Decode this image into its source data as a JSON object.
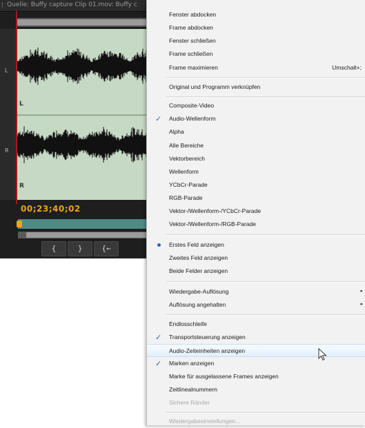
{
  "source_monitor": {
    "title": "Quelle: Buffy capture Clip 01.mov: Buffy c",
    "timecode": "00;23;40;02",
    "channel_marks": [
      "L",
      "R"
    ],
    "gutter_marks": [
      "L",
      "R"
    ],
    "transport_buttons": [
      {
        "name": "mark-in-button",
        "glyph": "{"
      },
      {
        "name": "mark-out-button",
        "glyph": "}"
      },
      {
        "name": "go-to-in-button",
        "glyph": "{←"
      }
    ]
  },
  "context_menu": {
    "items": [
      {
        "label": "Fenster abdocken"
      },
      {
        "label": "Frame abdocken"
      },
      {
        "label": "Fenster schließen"
      },
      {
        "label": "Frame schließen"
      },
      {
        "label": "Frame maximieren",
        "shortcut": "Umschalt+;"
      },
      {
        "label": "Original und Programm verknüpfen"
      },
      {
        "label": "Composite-Video"
      },
      {
        "label": "Audio-Wellenform",
        "checked": true
      },
      {
        "label": "Alpha"
      },
      {
        "label": "Alle Bereiche"
      },
      {
        "label": "Vektorbereich"
      },
      {
        "label": "Wellenform"
      },
      {
        "label": "YCbCr-Parade"
      },
      {
        "label": "RGB-Parade"
      },
      {
        "label": "Vektor-/Wellenform-/YCbCr-Parade"
      },
      {
        "label": "Vektor-/Wellenform-/RGB-Parade"
      },
      {
        "label": "Erstes Feld anzeigen",
        "radio": true
      },
      {
        "label": "Zweites Feld anzeigen"
      },
      {
        "label": "Beide Felder anzeigen"
      },
      {
        "label": "Wiedergabe-Auflösung",
        "submenu": true
      },
      {
        "label": "Auflösung angehalten",
        "submenu": true
      },
      {
        "label": "Endlosschleife"
      },
      {
        "label": "Transportsteuerung anzeigen",
        "checked": true
      },
      {
        "label": "Audio-Zeiteinheiten anzeigen",
        "highlighted": true
      },
      {
        "label": "Marken anzeigen",
        "checked": true
      },
      {
        "label": "Marke für ausgelassene Frames anzeigen"
      },
      {
        "label": "Zeitlinealnummern"
      },
      {
        "label": "Sichere Ränder",
        "disabled": true
      },
      {
        "label": "Wiedergabeeinstellungen...",
        "disabled": true
      }
    ]
  },
  "colors": {
    "waveform_bg": "#c6d9c5",
    "timecode": "#e9a51c",
    "check": "#2a65c8"
  }
}
